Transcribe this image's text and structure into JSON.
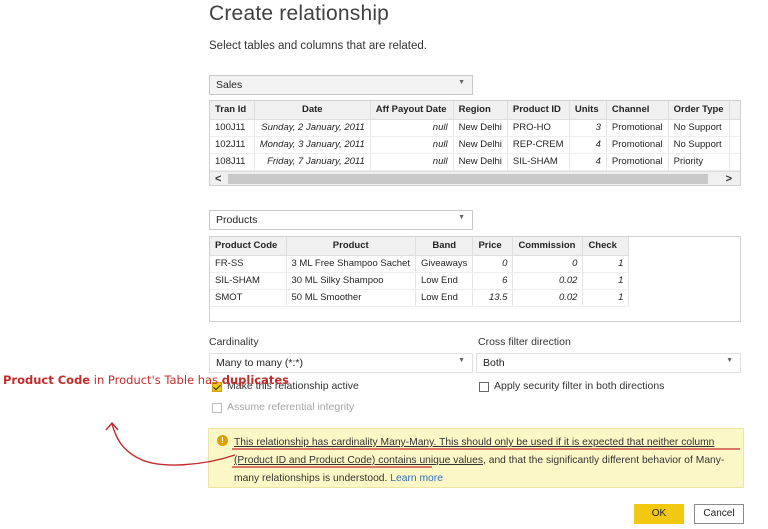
{
  "dialog": {
    "title": "Create relationship",
    "subtitle": "Select tables and columns that are related."
  },
  "sales": {
    "table_name": "Sales",
    "headers": [
      "Tran Id",
      "Date",
      "Aff Payout Date",
      "Region",
      "Product ID",
      "Units",
      "Channel",
      "Order Type"
    ],
    "rows": [
      [
        "100J11",
        "Sunday, 2 January, 2011",
        "null",
        "New Delhi",
        "PRO-HO",
        "3",
        "Promotional",
        "No Support"
      ],
      [
        "102J11",
        "Monday, 3 January, 2011",
        "null",
        "New Delhi",
        "REP-CREM",
        "4",
        "Promotional",
        "No Support"
      ],
      [
        "108J11",
        "Friday, 7 January, 2011",
        "null",
        "New Delhi",
        "SIL-SHAM",
        "4",
        "Promotional",
        "Priority"
      ]
    ]
  },
  "products": {
    "table_name": "Products",
    "headers": [
      "Product Code",
      "Product",
      "Band",
      "Price",
      "Commission",
      "Check"
    ],
    "rows": [
      [
        "FR-SS",
        "3 ML Free Shampoo Sachet",
        "Giveaways",
        "0",
        "0",
        "1"
      ],
      [
        "SIL-SHAM",
        "30 ML Silky Shampoo",
        "Low End",
        "6",
        "0.02",
        "1"
      ],
      [
        "SMOT",
        "50 ML Smoother",
        "Low End",
        "13.5",
        "0.02",
        "1"
      ]
    ]
  },
  "cardinality": {
    "label": "Cardinality",
    "value": "Many to many (*:*)"
  },
  "cross_filter": {
    "label": "Cross filter direction",
    "value": "Both"
  },
  "options": {
    "make_active": {
      "label": "Make this relationship active",
      "checked": true
    },
    "security_filter": {
      "label": "Apply security filter in both directions",
      "checked": false
    },
    "referential": {
      "label": "Assume referential integrity",
      "checked": false,
      "disabled": true
    }
  },
  "warning": {
    "part1": "This relationship has cardinality Many-Many. This should only be used if it is expected that neither column (Product ID and Product Code) contains unique values",
    "part2": ", and that the significantly different behavior of Many-many relationships is understood.",
    "link": "Learn more"
  },
  "buttons": {
    "ok": "OK",
    "cancel": "Cancel"
  },
  "annotation": {
    "bold1": "Product Code",
    "mid": " in Product's Table has ",
    "bold2": "duplicates"
  },
  "colors": {
    "accent": "#f2c811",
    "annotation": "#c42b2b",
    "link": "#2b6fc7"
  },
  "icons": [
    "dropdown-caret-icon",
    "scroll-left-icon",
    "scroll-right-icon",
    "warning-icon",
    "checkmark-icon"
  ]
}
